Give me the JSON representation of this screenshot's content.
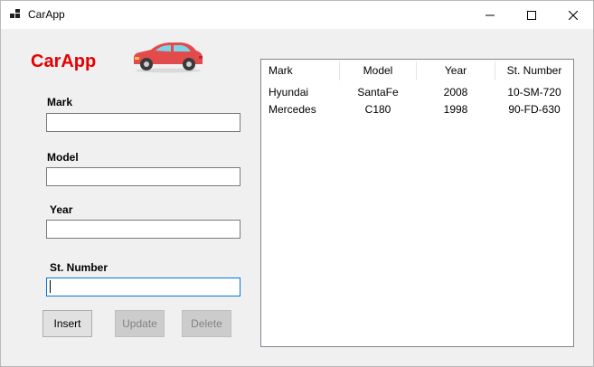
{
  "window": {
    "title": "CarApp"
  },
  "brand": {
    "text": "CarApp",
    "color": "#e60000",
    "icon": "car-icon"
  },
  "form": {
    "mark_label": "Mark",
    "model_label": "Model",
    "year_label": "Year",
    "stnumber_label": "St. Number",
    "mark_value": "",
    "model_value": "",
    "year_value": "",
    "stnumber_value": ""
  },
  "buttons": {
    "insert": "Insert",
    "update": "Update",
    "delete": "Delete"
  },
  "list": {
    "columns": [
      "Mark",
      "Model",
      "Year",
      "St. Number"
    ],
    "rows": [
      [
        "Hyundai",
        "SantaFe",
        "2008",
        "10-SM-720"
      ],
      [
        "Mercedes",
        "C180",
        "1998",
        "90-FD-630"
      ]
    ]
  }
}
